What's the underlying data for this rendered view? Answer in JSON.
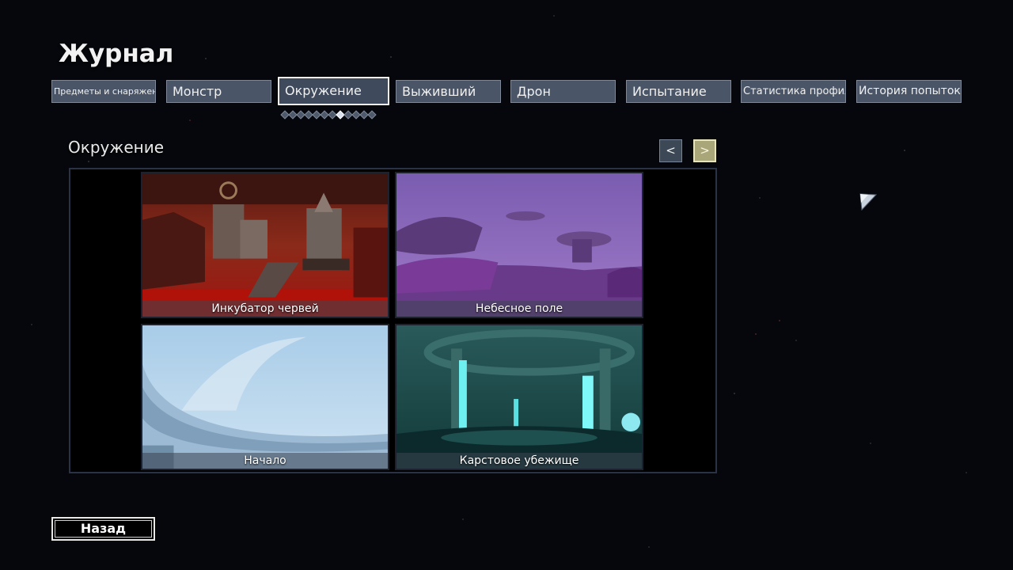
{
  "journal": {
    "title": "Журнал"
  },
  "tabs": [
    {
      "label": "Предметы и снаряжение",
      "active": false
    },
    {
      "label": "Монстр",
      "active": false
    },
    {
      "label": "Окружение",
      "active": true
    },
    {
      "label": "Выживший",
      "active": false
    },
    {
      "label": "Дрон",
      "active": false
    },
    {
      "label": "Испытание",
      "active": false
    },
    {
      "label": "Статистика профиля",
      "active": false
    },
    {
      "label": "История попыток",
      "active": false
    }
  ],
  "page_indicator": {
    "count": 12,
    "current": 8
  },
  "section": {
    "title": "Окружение"
  },
  "pager": {
    "prev_label": "<",
    "next_label": ">"
  },
  "environments": [
    {
      "name": "Инкубатор червей"
    },
    {
      "name": "Небесное поле"
    },
    {
      "name": "Начало"
    },
    {
      "name": "Карстовое убежище"
    }
  ],
  "footer": {
    "back_label": "Назад"
  },
  "colors": {
    "tab_bg": "#4a5668",
    "tab_border": "#7d8797",
    "next_btn": "#a9a67a",
    "background": "#05070c"
  }
}
